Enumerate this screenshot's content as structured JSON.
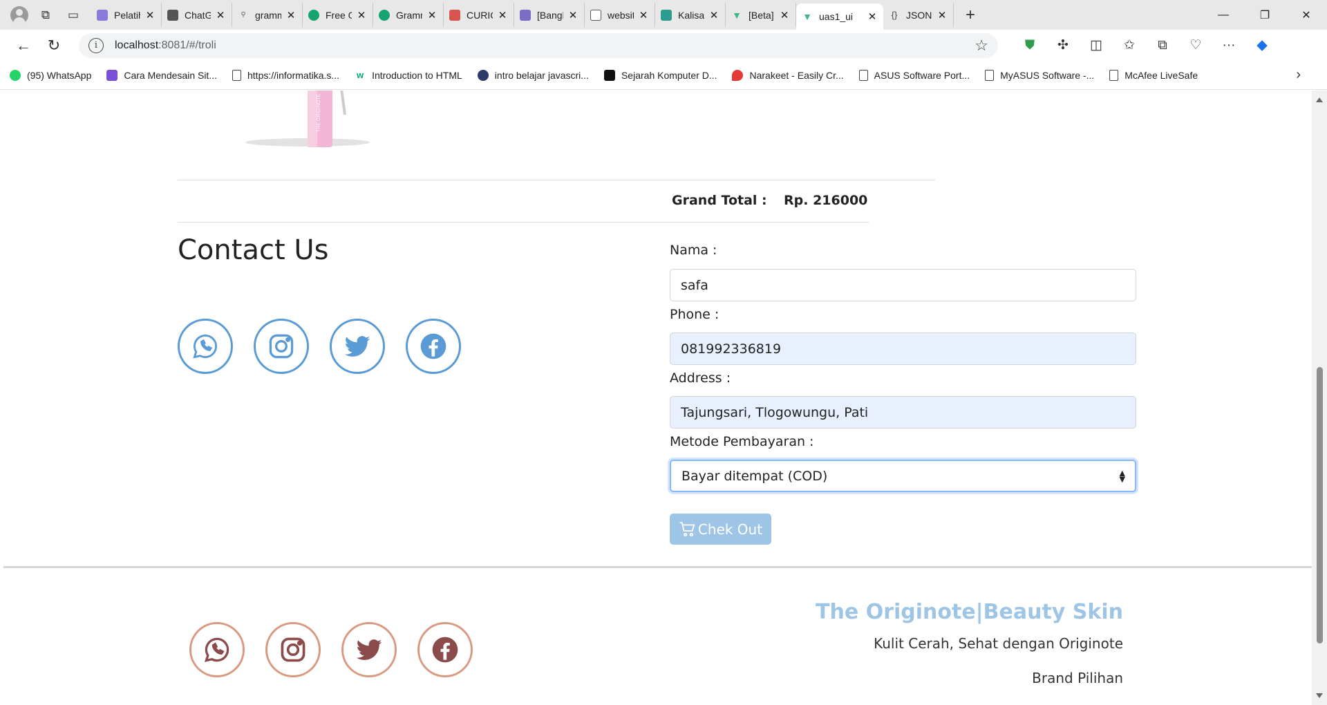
{
  "browser": {
    "tabs": [
      {
        "label": "Pelatiha",
        "favicon_color": "#8a7bd8"
      },
      {
        "label": "ChatGP",
        "favicon_color": "#555555"
      },
      {
        "label": "gramm",
        "favicon_color": "#888888"
      },
      {
        "label": "Free Gr",
        "favicon_color": "#15a46f"
      },
      {
        "label": "Gramm",
        "favicon_color": "#15a46f"
      },
      {
        "label": "CURICU",
        "favicon_color": "#d9534f"
      },
      {
        "label": "[Bangk",
        "favicon_color": "#7b6cc4"
      },
      {
        "label": "website",
        "favicon_color": "#666666"
      },
      {
        "label": "Kalisari",
        "favicon_color": "#2a9d8f"
      },
      {
        "label": "[Beta] s",
        "favicon_color": "#41b883"
      },
      {
        "label": "uas1_ui",
        "favicon_color": "#41b883",
        "active": true
      },
      {
        "label": "JSON S",
        "favicon_color": "#444444"
      }
    ],
    "url_host": "localhost",
    "url_path": ":8081/#/troli",
    "bookmarks": [
      {
        "label": "(95) WhatsApp",
        "icon": "whatsapp-icon",
        "color": "#25d366"
      },
      {
        "label": "Cara Mendesain Sit...",
        "icon": "site-icon",
        "color": "#7b4fd6"
      },
      {
        "label": "https://informatika.s...",
        "icon": "document-icon",
        "color": ""
      },
      {
        "label": "Introduction to HTML",
        "icon": "w3-icon",
        "color": "#04aa6d"
      },
      {
        "label": "intro belajar javascri...",
        "icon": "globe-icon",
        "color": "#2b3a67"
      },
      {
        "label": "Sejarah Komputer D...",
        "icon": "site-icon",
        "color": "#111111"
      },
      {
        "label": "Narakeet - Easily Cr...",
        "icon": "narakeet-icon",
        "color": "#e53935"
      },
      {
        "label": "ASUS Software Port...",
        "icon": "document-icon",
        "color": ""
      },
      {
        "label": "MyASUS Software -...",
        "icon": "document-icon",
        "color": ""
      },
      {
        "label": "McAfee LiveSafe",
        "icon": "document-icon",
        "color": ""
      }
    ]
  },
  "cart": {
    "grand_total_label": "Grand Total :",
    "grand_total_value": "Rp. 216000"
  },
  "contact": {
    "title": "Contact Us",
    "social_color": "#5b9bd5",
    "social_icons": [
      "whatsapp-icon",
      "instagram-icon",
      "twitter-icon",
      "facebook-icon"
    ]
  },
  "form": {
    "nama_label": "Nama :",
    "nama_value": "safa",
    "phone_label": "Phone :",
    "phone_value": "081992336819",
    "address_label": "Address :",
    "address_value": "Tajungsari, Tlogowungu, Pati",
    "payment_label": "Metode Pembayaran :",
    "payment_value": "Bayar ditempat (COD)",
    "checkout_label": "Chek Out"
  },
  "footer": {
    "brand": "The Originote|Beauty Skin",
    "tagline": "Kulit Cerah, Sehat dengan Originote",
    "brand_pick": "Brand Pilihan",
    "social_color": "#d89a82",
    "social_icon_color": "#8b4b4b",
    "brand_color": "#9ec5e5"
  }
}
